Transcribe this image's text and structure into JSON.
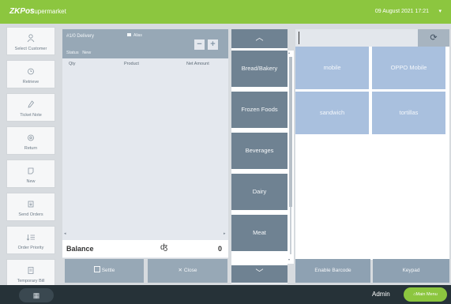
{
  "app": {
    "logo": "ZKPos",
    "store_name": "Supermarket",
    "datetime": "09 August 2021 17:21",
    "datetime_caret": "▾"
  },
  "sidebar": {
    "items": [
      {
        "label": "Select Customer",
        "icon": "person-icon"
      },
      {
        "label": "Retrieve",
        "icon": "retrieve-icon"
      },
      {
        "label": "Ticket Note",
        "icon": "note-icon"
      },
      {
        "label": "Return",
        "icon": "return-icon"
      },
      {
        "label": "New",
        "icon": "new-icon"
      },
      {
        "label": "Send Orders",
        "icon": "send-icon"
      },
      {
        "label": "Order Priority",
        "icon": "priority-icon"
      },
      {
        "label": "Temporary Bill",
        "icon": "bill-icon"
      }
    ]
  },
  "order": {
    "title": "#1/0 Delivery",
    "alias_label": "Alias",
    "status_label": "Status",
    "status_value": "New",
    "remove_label": "−",
    "add_label": "+",
    "columns": [
      "Qty",
      "Product",
      "Net Amount"
    ],
    "scroll_left": "◂",
    "scroll_right": "▸",
    "balance_label": "Balance",
    "balance_value": "0",
    "balance_icon": "ʤ",
    "settle_label": "Settle",
    "close_icon": "✕",
    "close_label": "Close"
  },
  "categories": {
    "up_arrow": "︿",
    "down_arrow": "﹀",
    "items": [
      "Bread/Bakery",
      "Frozen Foods",
      "Beverages",
      "Dairy",
      "Meat"
    ],
    "scroll_up": "▴",
    "scroll_down": "▾"
  },
  "search": {
    "value": "",
    "placeholder": "",
    "refresh_icon": "⟳"
  },
  "products": {
    "items": [
      "mobile",
      "OPPO Mobile",
      "sandwich",
      "tortillas"
    ]
  },
  "bottom_buttons": {
    "enable_barcode": "Enable Barcode",
    "keypad": "Keypad"
  },
  "status_bar": {
    "calculator_icon": "▦",
    "user": "Admin",
    "main_menu_icon": "⌂",
    "main_menu": "Main Menu"
  },
  "colors": {
    "brand_green": "#8cc63f",
    "category_button": "#6f8292",
    "product_tile": "#a9c0de",
    "bottom_bar": "#263238"
  }
}
